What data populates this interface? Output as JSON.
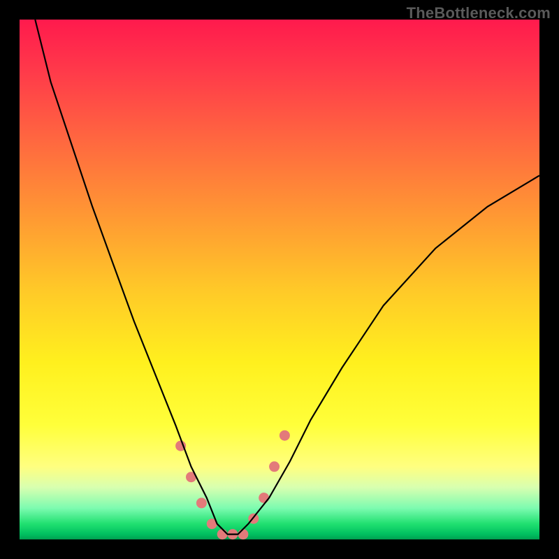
{
  "watermark": "TheBottleneck.com",
  "colors": {
    "frame": "#000000",
    "gradient_top": "#ff1a4d",
    "gradient_mid": "#fff01e",
    "gradient_bottom": "#00a050",
    "curve": "#000000",
    "markers": "#e37a7a"
  },
  "chart_data": {
    "type": "line",
    "title": "",
    "xlabel": "",
    "ylabel": "",
    "xlim": [
      0,
      100
    ],
    "ylim": [
      0,
      100
    ],
    "series": [
      {
        "name": "bottleneck-curve",
        "x": [
          3,
          6,
          10,
          14,
          18,
          22,
          26,
          30,
          33,
          36,
          38,
          40,
          42,
          44,
          48,
          52,
          56,
          62,
          70,
          80,
          90,
          100
        ],
        "y": [
          100,
          88,
          76,
          64,
          53,
          42,
          32,
          22,
          14,
          8,
          3,
          1,
          1,
          3,
          8,
          15,
          23,
          33,
          45,
          56,
          64,
          70
        ]
      }
    ],
    "markers": {
      "name": "bottom-markers",
      "x": [
        31,
        33,
        35,
        37,
        39,
        41,
        43,
        45,
        47,
        49,
        51
      ],
      "y": [
        18,
        12,
        7,
        3,
        1,
        1,
        1,
        4,
        8,
        14,
        20
      ]
    }
  }
}
